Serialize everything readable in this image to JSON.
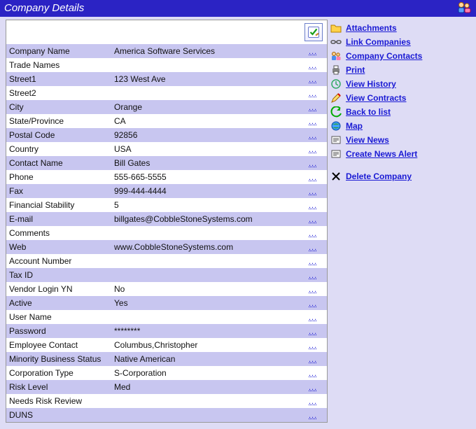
{
  "title": "Company Details",
  "edit_ellipsis": "...",
  "fields": [
    {
      "label": "Company Name",
      "value": "America Software Services"
    },
    {
      "label": "Trade Names",
      "value": ""
    },
    {
      "label": "Street1",
      "value": "123 West Ave"
    },
    {
      "label": "Street2",
      "value": ""
    },
    {
      "label": "City",
      "value": "Orange"
    },
    {
      "label": "State/Province",
      "value": "CA"
    },
    {
      "label": "Postal Code",
      "value": "92856"
    },
    {
      "label": "Country",
      "value": "USA"
    },
    {
      "label": "Contact Name",
      "value": "Bill Gates"
    },
    {
      "label": "Phone",
      "value": "555-665-5555"
    },
    {
      "label": "Fax",
      "value": "999-444-4444"
    },
    {
      "label": "Financial Stability",
      "value": "5"
    },
    {
      "label": "E-mail",
      "value": "billgates@CobbleStoneSystems.com"
    },
    {
      "label": "Comments",
      "value": ""
    },
    {
      "label": "Web",
      "value": "www.CobbleStoneSystems.com"
    },
    {
      "label": "Account Number",
      "value": ""
    },
    {
      "label": "Tax ID",
      "value": ""
    },
    {
      "label": "Vendor Login YN",
      "value": "No"
    },
    {
      "label": "Active",
      "value": "Yes"
    },
    {
      "label": "User Name",
      "value": ""
    },
    {
      "label": "Password",
      "value": "********"
    },
    {
      "label": "Employee Contact",
      "value": "Columbus,Christopher"
    },
    {
      "label": "Minority Business Status",
      "value": "Native American"
    },
    {
      "label": "Corporation Type",
      "value": "S-Corporation"
    },
    {
      "label": "Risk Level",
      "value": "Med"
    },
    {
      "label": "Needs Risk Review",
      "value": ""
    },
    {
      "label": "DUNS",
      "value": ""
    }
  ],
  "actions": [
    {
      "label": "Attachments",
      "icon": "folder"
    },
    {
      "label": "Link Companies",
      "icon": "link"
    },
    {
      "label": "Company Contacts",
      "icon": "people"
    },
    {
      "label": "Print",
      "icon": "printer"
    },
    {
      "label": "View History",
      "icon": "history"
    },
    {
      "label": "View Contracts",
      "icon": "pen"
    },
    {
      "label": "Back to list",
      "icon": "back"
    },
    {
      "label": "Map",
      "icon": "globe"
    },
    {
      "label": "View News",
      "icon": "news"
    },
    {
      "label": "Create News Alert",
      "icon": "news"
    }
  ],
  "delete_action": {
    "label": "Delete Company",
    "icon": "delete"
  }
}
